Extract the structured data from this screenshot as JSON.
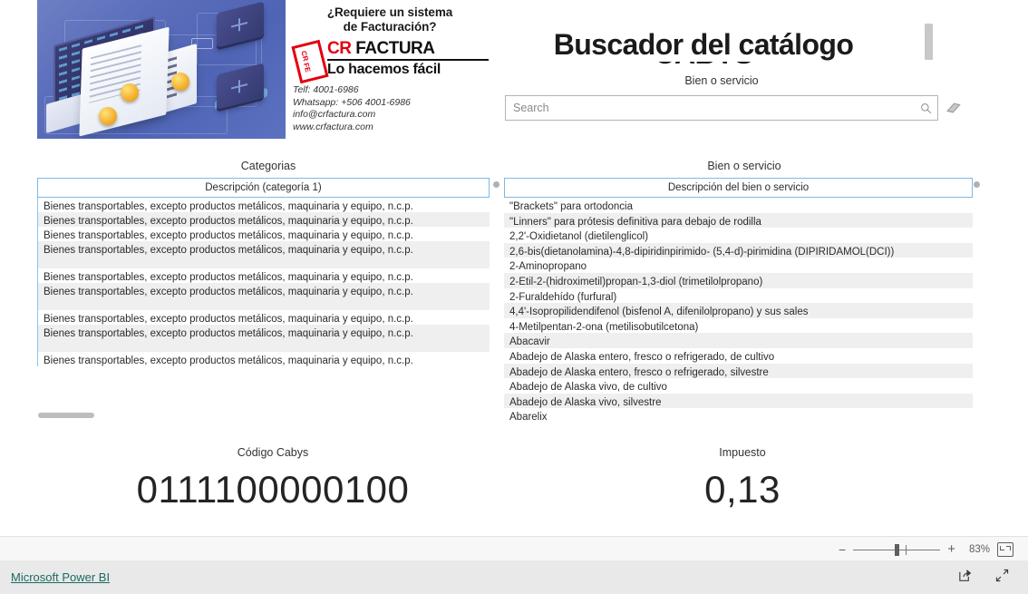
{
  "banner": {
    "headline_line1": "¿Requiere un sistema",
    "headline_line2": "de Facturación?",
    "logo_cr": "CR",
    "logo_factura": "FACTURA",
    "logo_tagline": "Lo hacemos fácil",
    "logo_badge_top": "CR",
    "logo_badge_bottom": "FE",
    "contact_phone": "Telf: 4001-6986",
    "contact_whatsapp": "Whatsapp: +506 4001-6986",
    "contact_email": "info@crfactura.com",
    "contact_web": "www.crfactura.com"
  },
  "header": {
    "title": "Buscador del catálogo",
    "subtitle_clipped": "CABYS"
  },
  "search": {
    "label": "Bien o servicio",
    "placeholder": "Search",
    "value": "",
    "icon": "search-icon",
    "clear_icon": "eraser-icon"
  },
  "categories_panel": {
    "title": "Categorias",
    "column_header": "Descripción (categoría 1)",
    "rows": [
      "Bienes transportables, excepto productos metálicos, maquinaria y equipo, n.c.p.",
      "Bienes transportables, excepto productos metálicos, maquinaria y equipo, n.c.p.",
      "Bienes transportables, excepto productos metálicos, maquinaria y equipo, n.c.p.",
      "Bienes transportables, excepto productos metálicos, maquinaria y equipo, n.c.p.",
      "Bienes transportables, excepto productos metálicos, maquinaria y equipo, n.c.p.",
      "Bienes transportables, excepto productos metálicos, maquinaria y equipo, n.c.p.",
      "Bienes transportables, excepto productos metálicos, maquinaria y equipo, n.c.p.",
      "Bienes transportables, excepto productos metálicos, maquinaria y equipo, n.c.p.",
      "Bienes transportables, excepto productos metálicos, maquinaria y equipo, n.c.p."
    ]
  },
  "goods_panel": {
    "title": "Bien o servicio",
    "column_header": "Descripción del bien o servicio",
    "rows": [
      "\"Brackets\" para ortodoncia",
      "\"Linners\" para prótesis definitiva para debajo de rodilla",
      "2,2'-Oxidietanol (dietilenglicol)",
      "2,6-bis(dietanolamina)-4,8-dipiridinpirimido- (5,4-d)-pirimidina (DIPIRIDAMOL(DCI))",
      "2-Aminopropano",
      "2-Etil-2-(hidroximetil)propan-1,3-diol (trimetilolpropano)",
      "2-Furaldehído (furfural)",
      "4,4'-Isopropilidendifenol (bisfenol A, difenilolpropano) y sus sales",
      "4-Metilpentan-2-ona (metilisobutilcetona)",
      "Abacavir",
      "Abadejo de Alaska entero, fresco o refrigerado, de cultivo",
      "Abadejo de Alaska entero, fresco o refrigerado, silvestre",
      "Abadejo de Alaska vivo, de cultivo",
      "Abadejo de Alaska vivo, silvestre",
      "Abarelix"
    ]
  },
  "cards": [
    {
      "label": "Código Cabys",
      "value": "0111100000100"
    },
    {
      "label": "Impuesto",
      "value": "0,13"
    }
  ],
  "zoom_bar": {
    "minus": "−",
    "plus": "+",
    "percent": "83%",
    "fit_icon": "fit-to-page-icon"
  },
  "status_bar": {
    "brand": "Microsoft Power BI",
    "share_icon": "share-icon",
    "fullscreen_icon": "fullscreen-icon"
  },
  "colors": {
    "accent_blue": "#7cb9e8",
    "row_alt": "#efefef",
    "brand_red": "#e3000f",
    "link_teal": "#1a6b63"
  }
}
